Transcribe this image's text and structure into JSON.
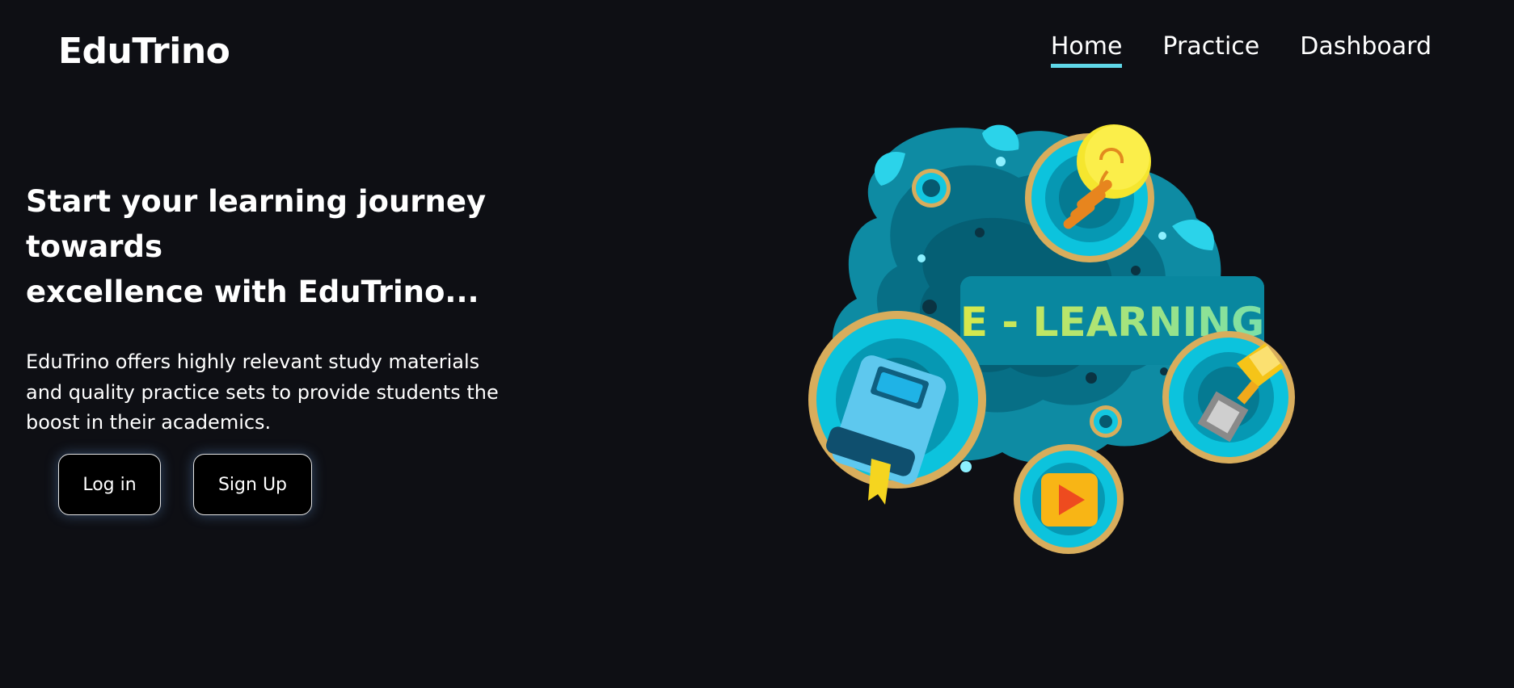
{
  "brand": {
    "name": "EduTrino"
  },
  "nav": {
    "items": [
      {
        "label": "Home",
        "active": true
      },
      {
        "label": "Practice",
        "active": false
      },
      {
        "label": "Dashboard",
        "active": false
      }
    ]
  },
  "hero": {
    "headline_line1": "Start your learning journey towards",
    "headline_line2": "excellence with EduTrino...",
    "desc_line1": "EduTrino offers highly relevant study materials",
    "desc_line2": "and quality practice sets to provide students the",
    "desc_line3": "boost in their academics.",
    "login_label": "Log in",
    "signup_label": "Sign Up"
  },
  "illustration": {
    "banner_text": "E - LEARNING",
    "icons": [
      "lightbulb-icon",
      "book-icon",
      "trophy-icon",
      "play-icon"
    ]
  },
  "colors": {
    "background": "#0e0f14",
    "accent": "#5fd7e8",
    "banner_text_gradient": [
      "#d8e84a",
      "#7be0a8"
    ]
  }
}
